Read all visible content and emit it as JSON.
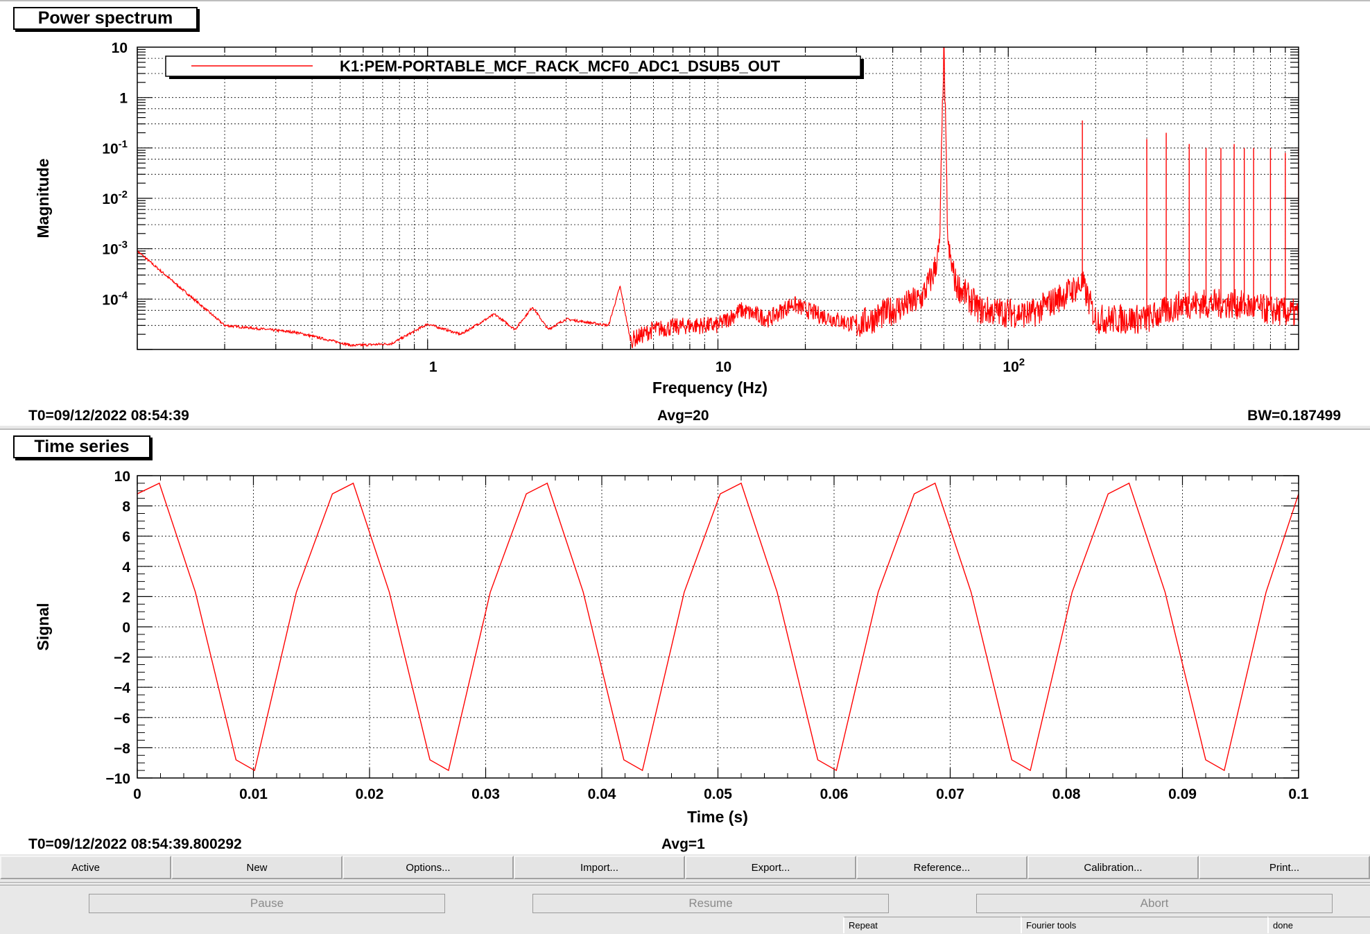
{
  "spectrum": {
    "panel_title": "Power spectrum",
    "legend_label": "K1:PEM-PORTABLE_MCF_RACK_MCF0_ADC1_DSUB5_OUT",
    "footer": {
      "t0": "T0=09/12/2022 08:54:39",
      "avg": "Avg=20",
      "bw": "BW=0.187499"
    }
  },
  "timeseries": {
    "panel_title": "Time series",
    "footer": {
      "t0": "T0=09/12/2022 08:54:39.800292",
      "avg": "Avg=1"
    }
  },
  "toolbar": [
    "Active",
    "New",
    "Options...",
    "Import...",
    "Export...",
    "Reference...",
    "Calibration...",
    "Print..."
  ],
  "controls": {
    "pause": "Pause",
    "resume": "Resume",
    "abort": "Abort"
  },
  "status": {
    "repeat": "Repeat",
    "fourier": "Fourier tools",
    "state": "done"
  },
  "colors": {
    "trace": "#ff0000",
    "grid": "#000000",
    "panel_bg": "#ffffff",
    "window_bg": "#e8e8e8"
  },
  "chart_data": [
    {
      "type": "line",
      "title": "",
      "xlabel": "Frequency (Hz)",
      "ylabel": "Magnitude",
      "x_scale": "log",
      "y_scale": "log",
      "xlim": [
        0.1,
        1000
      ],
      "ylim": [
        1e-05,
        10
      ],
      "grid": true,
      "legend": "top-left",
      "x_tick_labels": [
        "1",
        "10",
        "10^2"
      ],
      "y_tick_labels": [
        "10",
        "1",
        "10^-1",
        "10^-2",
        "10^-3",
        "10^-4"
      ],
      "series": [
        {
          "name": "K1:PEM-PORTABLE_MCF_RACK_MCF0_ADC1_DSUB5_OUT",
          "color": "#ff0000",
          "points": [
            [
              0.1,
              0.0009
            ],
            [
              0.2,
              3e-05
            ],
            [
              0.35,
              2.2e-05
            ],
            [
              0.55,
              1.2e-05
            ],
            [
              0.75,
              1.3e-05
            ],
            [
              1.0,
              3.2e-05
            ],
            [
              1.3,
              2e-05
            ],
            [
              1.7,
              5e-05
            ],
            [
              2.0,
              2.5e-05
            ],
            [
              2.3,
              7e-05
            ],
            [
              2.6,
              2.5e-05
            ],
            [
              3.0,
              4e-05
            ],
            [
              3.5,
              3.5e-05
            ],
            [
              4.2,
              3e-05
            ],
            [
              4.6,
              0.00018
            ],
            [
              5.0,
              1.5e-05
            ],
            [
              6.0,
              2.5e-05
            ],
            [
              8.0,
              3e-05
            ],
            [
              10.0,
              3e-05
            ],
            [
              12.0,
              6e-05
            ],
            [
              15.0,
              4e-05
            ],
            [
              18.0,
              8e-05
            ],
            [
              22.0,
              5e-05
            ],
            [
              30.0,
              3e-05
            ],
            [
              40.0,
              6e-05
            ],
            [
              50.0,
              0.0001
            ],
            [
              55.0,
              0.0003
            ],
            [
              58.0,
              0.001
            ],
            [
              60.0,
              12.0
            ],
            [
              62.0,
              0.001
            ],
            [
              66.0,
              0.0002
            ],
            [
              80.0,
              6e-05
            ],
            [
              120.0,
              5e-05
            ],
            [
              180.0,
              0.0002
            ],
            [
              200.0,
              4e-05
            ],
            [
              300.0,
              4e-05
            ],
            [
              400.0,
              8e-05
            ],
            [
              600.0,
              8e-05
            ],
            [
              800.0,
              6e-05
            ],
            [
              1000.0,
              5e-05
            ]
          ],
          "peaks": [
            [
              60,
              12.0
            ],
            [
              180,
              0.35
            ],
            [
              300,
              0.15
            ],
            [
              350,
              0.2
            ],
            [
              420,
              0.12
            ],
            [
              480,
              0.1
            ],
            [
              540,
              0.1
            ],
            [
              600,
              0.12
            ],
            [
              650,
              0.1
            ],
            [
              700,
              0.1
            ],
            [
              800,
              0.1
            ],
            [
              900,
              0.08
            ],
            [
              1000,
              0.1
            ]
          ]
        }
      ]
    },
    {
      "type": "line",
      "title": "",
      "xlabel": "Time (s)",
      "ylabel": "Signal",
      "xlim": [
        0,
        0.1
      ],
      "ylim": [
        -10,
        10
      ],
      "grid": true,
      "x_ticks": [
        0,
        0.01,
        0.02,
        0.03,
        0.04,
        0.05,
        0.06,
        0.07,
        0.08,
        0.09,
        0.1
      ],
      "x_tick_labels": [
        "0",
        "0.01",
        "0.02",
        "0.03",
        "0.04",
        "0.05",
        "0.06",
        "0.07",
        "0.08",
        "0.09",
        "0.1"
      ],
      "y_ticks": [
        10,
        8,
        6,
        4,
        2,
        0,
        -2,
        -4,
        -6,
        -8,
        -10
      ],
      "series": [
        {
          "name": "",
          "color": "#ff0000",
          "points": [
            [
              0.0,
              8.8
            ],
            [
              0.0019,
              9.5
            ],
            [
              0.005,
              2.3
            ],
            [
              0.0085,
              -8.8
            ],
            [
              0.0101,
              -9.5
            ],
            [
              0.0137,
              2.3
            ],
            [
              0.0168,
              8.8
            ],
            [
              0.0186,
              9.5
            ],
            [
              0.0217,
              2.3
            ],
            [
              0.0252,
              -8.8
            ],
            [
              0.0268,
              -9.5
            ],
            [
              0.0304,
              2.3
            ],
            [
              0.0335,
              8.8
            ],
            [
              0.0353,
              9.5
            ],
            [
              0.0384,
              2.3
            ],
            [
              0.0419,
              -8.8
            ],
            [
              0.0435,
              -9.5
            ],
            [
              0.0471,
              2.3
            ],
            [
              0.0502,
              8.8
            ],
            [
              0.052,
              9.5
            ],
            [
              0.0551,
              2.3
            ],
            [
              0.0586,
              -8.8
            ],
            [
              0.0602,
              -9.5
            ],
            [
              0.0638,
              2.3
            ],
            [
              0.0669,
              8.8
            ],
            [
              0.0687,
              9.5
            ],
            [
              0.0718,
              2.3
            ],
            [
              0.0753,
              -8.8
            ],
            [
              0.0769,
              -9.5
            ],
            [
              0.0805,
              2.3
            ],
            [
              0.0836,
              8.8
            ],
            [
              0.0854,
              9.5
            ],
            [
              0.0885,
              2.3
            ],
            [
              0.092,
              -8.8
            ],
            [
              0.0936,
              -9.5
            ],
            [
              0.0972,
              2.3
            ],
            [
              0.1,
              8.8
            ]
          ]
        }
      ]
    }
  ]
}
